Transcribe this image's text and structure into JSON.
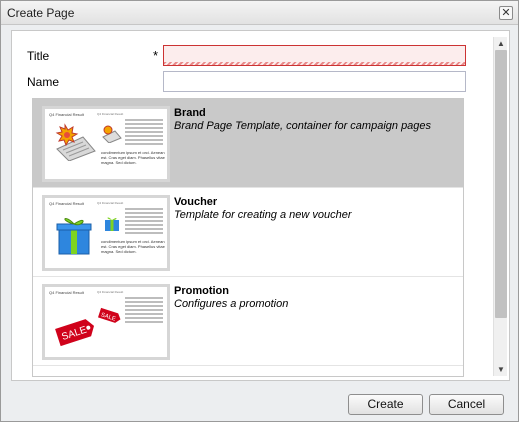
{
  "window": {
    "title": "Create Page"
  },
  "form": {
    "title_label": "Title",
    "title_required": "*",
    "title_value": "",
    "name_label": "Name",
    "name_value": ""
  },
  "templates": [
    {
      "name": "Brand",
      "description": "Brand Page Template, container for campaign pages",
      "selected": true,
      "thumbnail": {
        "heading": "Q4 Financial Result",
        "nav": "Q4 Financial Result",
        "body": "condimentum ipsum et orci. Aenean est. Cras eget diam. Phasellus vitae magna. Sed dictum.",
        "image": "newspaper-icon"
      }
    },
    {
      "name": "Voucher",
      "description": "Template for creating a new voucher",
      "selected": false,
      "thumbnail": {
        "heading": "Q4 Financial Result",
        "nav": "Q4 Financial Result",
        "body": "condimentum ipsum et orci. Aenean est. Cras eget diam. Phasellus vitae magna. Sed dictum.",
        "image": "gift-box-icon"
      }
    },
    {
      "name": "Promotion",
      "description": "Configures a promotion",
      "selected": false,
      "thumbnail": {
        "heading": "Q4 Financial Result",
        "nav": "Q4 Financial Result",
        "body": "",
        "image": "sale-tag-icon",
        "tag_text": "SALE"
      }
    }
  ],
  "buttons": {
    "create": "Create",
    "cancel": "Cancel"
  },
  "colors": {
    "selected_row": "#c9c9c9",
    "invalid_field": "#fceded"
  }
}
